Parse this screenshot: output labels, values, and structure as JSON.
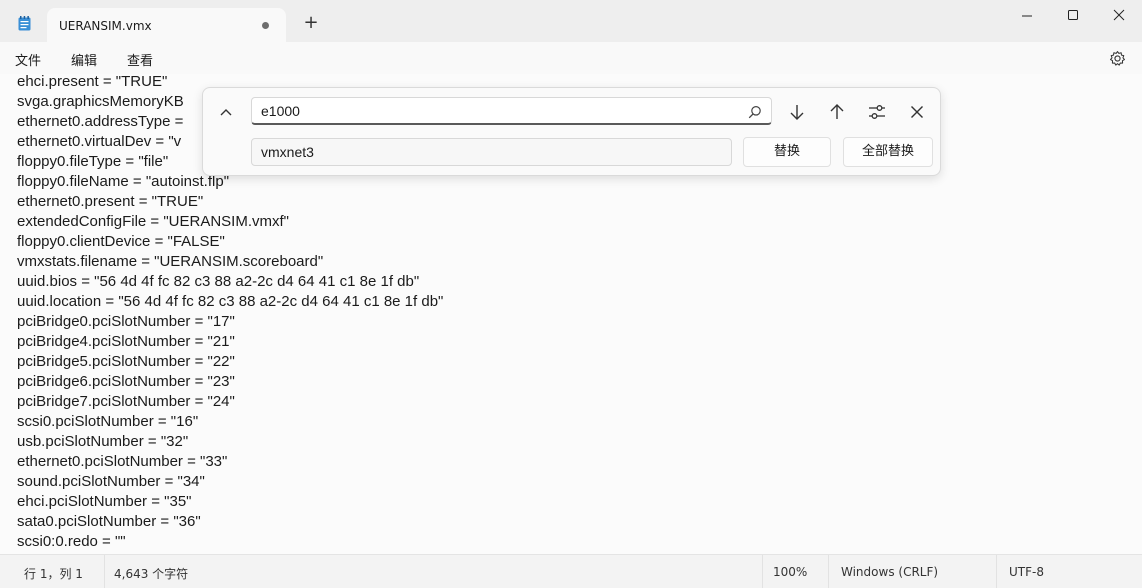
{
  "window": {
    "tab_title": "UERANSIM.vmx",
    "new_tab_glyph": "+",
    "controls": [
      "minimize-icon",
      "maximize-icon",
      "close-icon"
    ]
  },
  "menu": {
    "items": [
      "文件",
      "编辑",
      "查看"
    ],
    "settings_icon": "gear-icon"
  },
  "editor": {
    "lines": [
      "ehci.present = \"TRUE\"",
      "svga.graphicsMemoryKB",
      "ethernet0.addressType =",
      "ethernet0.virtualDev = \"v",
      "floppy0.fileType = \"file\"",
      "floppy0.fileName = \"autoinst.flp\"",
      "ethernet0.present = \"TRUE\"",
      "extendedConfigFile = \"UERANSIM.vmxf\"",
      "floppy0.clientDevice = \"FALSE\"",
      "vmxstats.filename = \"UERANSIM.scoreboard\"",
      "uuid.bios = \"56 4d 4f fc 82 c3 88 a2-2c d4 64 41 c1 8e 1f db\"",
      "uuid.location = \"56 4d 4f fc 82 c3 88 a2-2c d4 64 41 c1 8e 1f db\"",
      "pciBridge0.pciSlotNumber = \"17\"",
      "pciBridge4.pciSlotNumber = \"21\"",
      "pciBridge5.pciSlotNumber = \"22\"",
      "pciBridge6.pciSlotNumber = \"23\"",
      "pciBridge7.pciSlotNumber = \"24\"",
      "scsi0.pciSlotNumber = \"16\"",
      "usb.pciSlotNumber = \"32\"",
      "ethernet0.pciSlotNumber = \"33\"",
      "sound.pciSlotNumber = \"34\"",
      "ehci.pciSlotNumber = \"35\"",
      "sata0.pciSlotNumber = \"36\"",
      "scsi0:0.redo = \"\""
    ]
  },
  "find_replace": {
    "find_value": "e1000",
    "replace_value": "vmxnet3",
    "replace_button": "替换",
    "replace_all_button": "全部替换"
  },
  "status": {
    "position": "行 1，列 1",
    "char_count": "4,643 个字符",
    "zoom": "100%",
    "line_ending": "Windows (CRLF)",
    "encoding": "UTF-8"
  }
}
